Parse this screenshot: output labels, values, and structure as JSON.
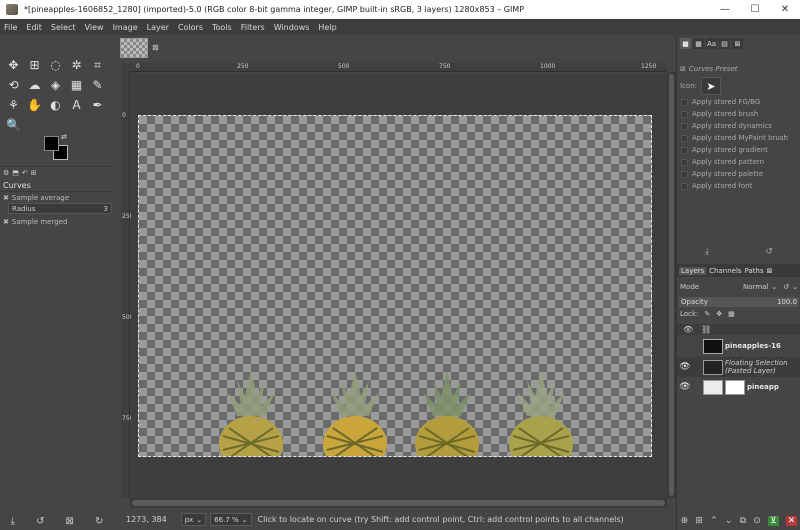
{
  "window": {
    "title": "*[pineapples-1606852_1280] (imported)-5.0 (RGB color 8-bit gamma integer, GIMP built-in sRGB, 3 layers) 1280x853 – GIMP",
    "minimize": "—",
    "maximize": "☐",
    "close": "✕"
  },
  "menu": [
    "File",
    "Edit",
    "Select",
    "View",
    "Image",
    "Layer",
    "Colors",
    "Tools",
    "Filters",
    "Windows",
    "Help"
  ],
  "toolbox": {
    "tools": [
      "move-icon",
      "align-icon",
      "free-select-icon",
      "fuzzy-select-icon",
      "crop-icon",
      "unified-transform-icon",
      "warp-icon",
      "bucket-fill-icon",
      "blend-icon",
      "paintbrush-icon",
      "clone-icon",
      "smudge-icon",
      "dodge-icon",
      "text-icon",
      "color-picker-icon",
      "zoom-icon"
    ],
    "tool_glyphs": [
      "✥",
      "⊞",
      "◌",
      "✲",
      "⌗",
      "⟲",
      "☁",
      "◈",
      "▦",
      "✎",
      "⚘",
      "✋",
      "◐",
      "A",
      "✒",
      "🔍"
    ],
    "option_tabs": [
      "⚙",
      "⬒",
      "↶",
      "⊞"
    ],
    "options_title": "Curves",
    "sample_average": "Sample average",
    "radius_label": "Radius",
    "radius_value": "3",
    "sample_merged": "Sample merged",
    "bottom_icons": [
      "⤓",
      "↺",
      "⊠",
      "↻"
    ]
  },
  "rulers": {
    "top": [
      "0",
      "250",
      "500",
      "750",
      "1000",
      "1250"
    ],
    "left": [
      "0",
      "250",
      "500",
      "750"
    ]
  },
  "status": {
    "coords": "1273, 384",
    "unit": "px",
    "zoom": "66.7 %",
    "message": "Click to locate on curve (try Shift: add control point, Ctrl: add control points to all channels)"
  },
  "presets": {
    "title": "Curves Preset",
    "icon_label": "Icon:",
    "items": [
      "Apply stored FG/BG",
      "Apply stored brush",
      "Apply stored dynamics",
      "Apply stored MyPaint brush",
      "Apply stored gradient",
      "Apply stored pattern",
      "Apply stored palette",
      "Apply stored font"
    ],
    "buttons": [
      "⤓",
      "↺"
    ]
  },
  "layers": {
    "tabs": [
      "Layers",
      "Channels",
      "Paths"
    ],
    "mode_label": "Mode",
    "mode_value": "Normal",
    "opacity_label": "Opacity",
    "opacity_value": "100.0",
    "lock_label": "Lock:",
    "items": [
      {
        "name": "pineapples-16",
        "style": "bold",
        "visible": false
      },
      {
        "name": "Floating Selection\n(Pasted Layer)",
        "style": "italic",
        "visible": true
      },
      {
        "name": "pineapp",
        "style": "bold",
        "visible": true
      }
    ],
    "bottom_icons": [
      "⊕",
      "⊞",
      "⌃",
      "⌄",
      "⧉",
      "⊙",
      "⊻",
      "✕"
    ]
  },
  "colors": {
    "background": "#454545",
    "menubar": "#3d3d3d",
    "accent_green": "#3a8a3a",
    "accent_red": "#b43a3a"
  }
}
